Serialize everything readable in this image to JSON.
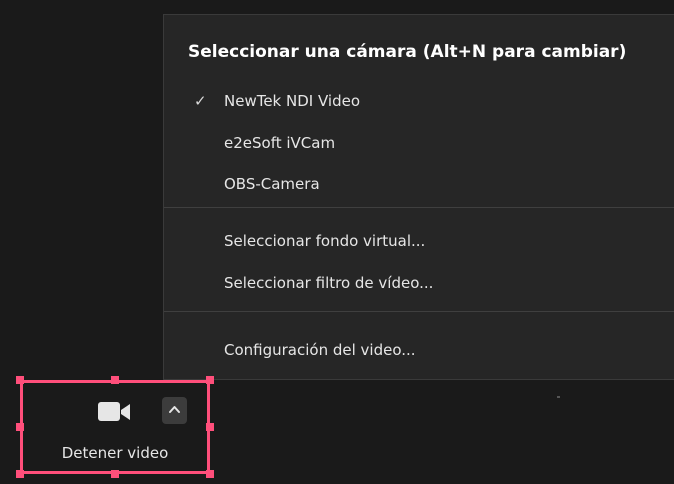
{
  "camera_menu": {
    "title": "Seleccionar una cámara (Alt+N para cambiar)",
    "check_icon": "checkmark-icon",
    "cameras": [
      {
        "label": "NewTek NDI Video",
        "selected": true
      },
      {
        "label": "e2eSoft iVCam",
        "selected": false
      },
      {
        "label": "OBS-Camera",
        "selected": false
      }
    ],
    "options": [
      {
        "label": "Seleccionar fondo virtual..."
      },
      {
        "label": "Seleccionar filtro de vídeo..."
      }
    ],
    "settings": {
      "label": "Configuración del video..."
    }
  },
  "toolbar": {
    "video_button": {
      "label": "Detener video",
      "icon": "video-camera-icon",
      "caret_icon": "chevron-up-icon"
    },
    "highlight_color": "#ff4f7b"
  }
}
